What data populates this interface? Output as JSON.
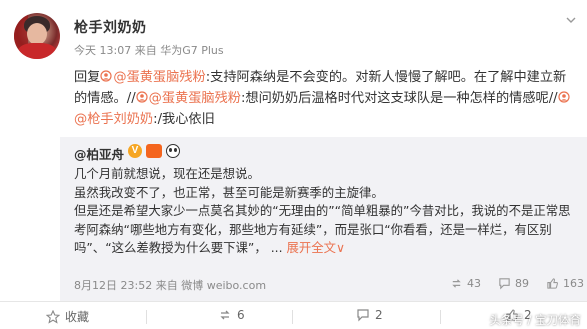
{
  "post": {
    "username": "枪手刘奶奶",
    "time": "今天 13:07",
    "source_prefix": "来自",
    "source": "华为G7 Plus",
    "text": {
      "reply_word": "回复",
      "mention_1": "@蛋黄蛋脑残粉",
      "seg_1": ":支持阿森纳是不会变的。对新人慢慢了解吧。在了解中建立新的情感。//",
      "mention_2": "@蛋黄蛋脑残粉",
      "seg_2": ":想问奶奶后温格时代对这支球队是一种怎样的情感呢//",
      "mention_3": "@枪手刘奶奶",
      "seg_3": ":/我心依旧"
    }
  },
  "repost": {
    "author": "@柏亚舟",
    "paragraphs": [
      "几个月前就想说，现在还是想说。",
      "虽然我改变不了，也正常，甚至可能是新赛季的主旋律。",
      "但是还是希望大家少一点莫名其妙的“无理由的”“简单粗暴的”今昔对比，我说的不是正常思考阿森纳“哪些地方有变化，那些地方有延续”，而是张口“你看看，还是一样烂，有区别吗”、“这么差教授为什么要下课”，"
    ],
    "ellipsis": "...",
    "expand_label": "展开全文",
    "expand_arrow": "∨",
    "timestamp": "8月12日 23:52",
    "source_prefix": "来自",
    "source": "微博 weibo.com",
    "stats": {
      "reposts": "43",
      "comments": "89",
      "likes": "163"
    }
  },
  "toolbar": {
    "favorite": "收藏",
    "repost_count": "6",
    "comment_count": "2",
    "like_count": "2"
  },
  "watermark": "头条号 / 宝刀体育",
  "colors": {
    "accent": "#eb7350",
    "repost_bg": "#f2f2f5",
    "meta": "#8a8a8a"
  }
}
